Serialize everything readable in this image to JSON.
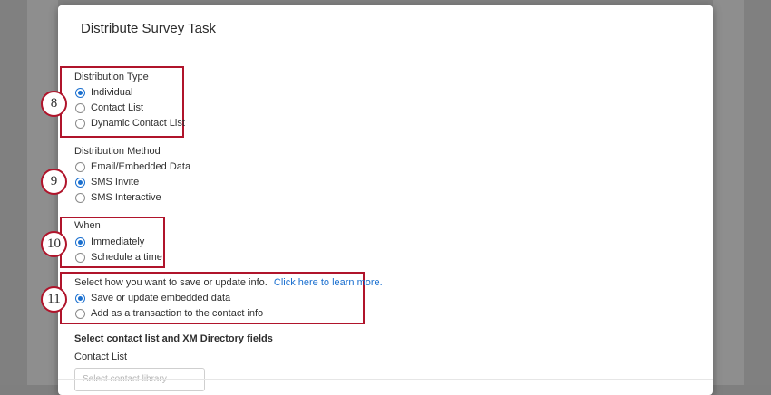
{
  "modal": {
    "title": "Distribute Survey Task"
  },
  "badges": [
    "8",
    "9",
    "10",
    "11"
  ],
  "distribution_type": {
    "label": "Distribution Type",
    "options": [
      {
        "label": "Individual",
        "selected": true
      },
      {
        "label": "Contact List",
        "selected": false
      },
      {
        "label": "Dynamic Contact List",
        "selected": false
      }
    ]
  },
  "distribution_method": {
    "label": "Distribution Method",
    "options": [
      {
        "label": "Email/Embedded Data",
        "selected": false
      },
      {
        "label": "SMS Invite",
        "selected": true
      },
      {
        "label": "SMS Interactive",
        "selected": false
      }
    ]
  },
  "when": {
    "label": "When",
    "options": [
      {
        "label": "Immediately",
        "selected": true
      },
      {
        "label": "Schedule a time",
        "selected": false
      }
    ]
  },
  "save_info": {
    "label": "Select how you want to save or update info.",
    "link": "Click here to learn more.",
    "options": [
      {
        "label": "Save or update embedded data",
        "selected": true
      },
      {
        "label": "Add as a transaction to the contact info",
        "selected": false
      }
    ]
  },
  "contact_fields": {
    "heading": "Select contact list and XM Directory fields",
    "contact_list_label": "Contact List",
    "placeholder": "Select contact library"
  },
  "colors": {
    "accent": "#1a6fcf",
    "highlight": "#b0142b"
  }
}
